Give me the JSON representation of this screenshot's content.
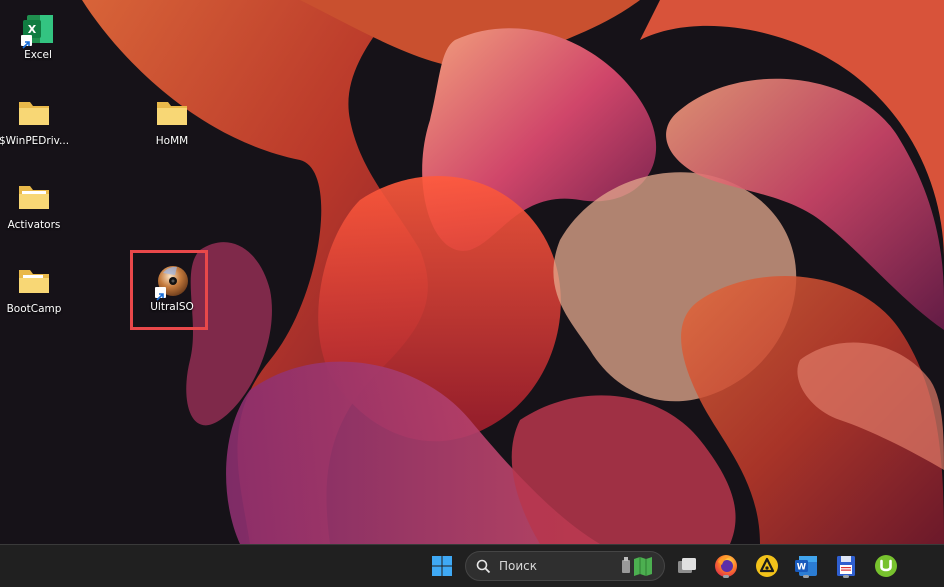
{
  "desktop": {
    "icons": [
      {
        "label": "Excel",
        "icon": "excel-shortcut-icon"
      },
      {
        "label": "$WinPEDriv...",
        "icon": "folder-icon"
      },
      {
        "label": "HoMM",
        "icon": "folder-icon"
      },
      {
        "label": "Activators",
        "icon": "folder-icon"
      },
      {
        "label": "BootCamp",
        "icon": "folder-icon"
      },
      {
        "label": "UltraISO",
        "icon": "ultraiso-disc-shortcut-icon",
        "highlighted": true
      }
    ],
    "highlight_color": "#e8484a"
  },
  "taskbar": {
    "search": {
      "placeholder": "Поиск"
    },
    "pinned": [
      "start-icon",
      "search-icon",
      "task-view-icon",
      "firefox-icon",
      "aimp-icon",
      "word-icon",
      "save-disk-icon",
      "utorrent-icon"
    ]
  }
}
